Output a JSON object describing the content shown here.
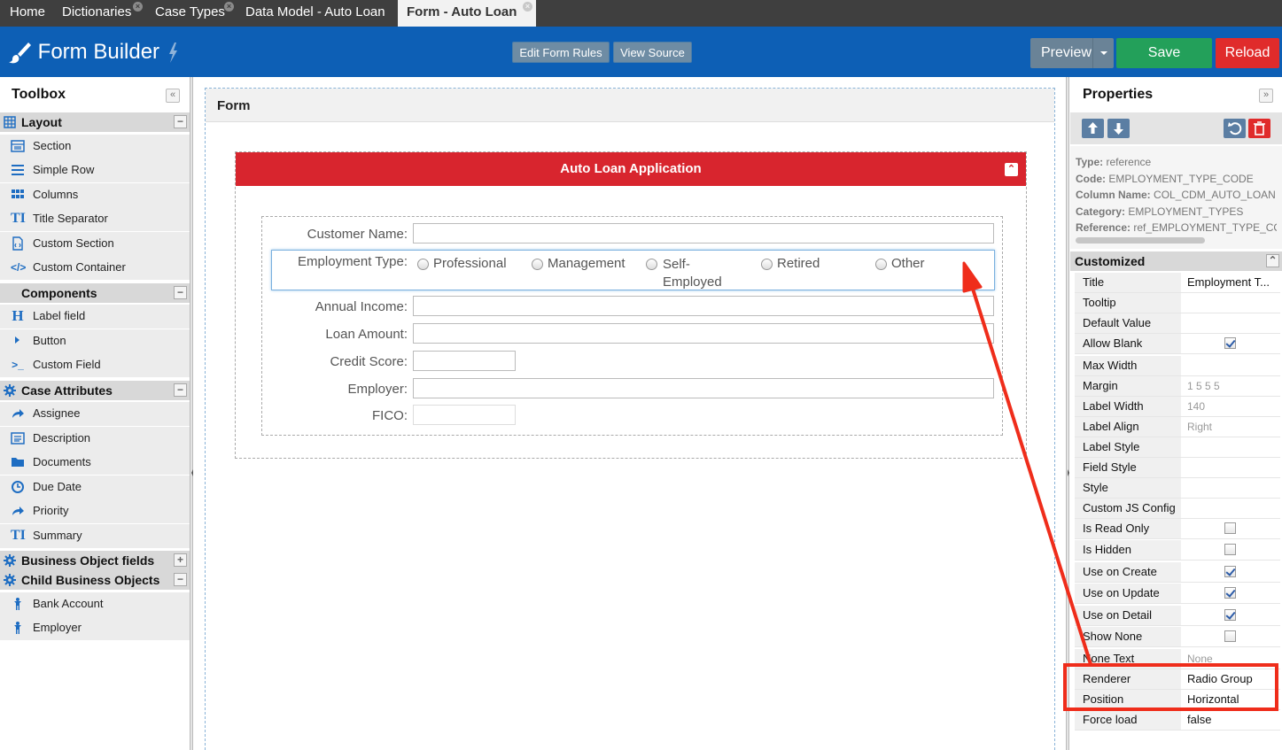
{
  "tabs": [
    {
      "label": "Home",
      "closable": false,
      "active": false
    },
    {
      "label": "Dictionaries",
      "closable": true,
      "active": false
    },
    {
      "label": "Case Types",
      "closable": true,
      "active": false
    },
    {
      "label": "Data Model - Auto Loan",
      "closable": false,
      "active": false
    },
    {
      "label": "Form - Auto Loan",
      "closable": true,
      "active": true
    }
  ],
  "header": {
    "title": "Form Builder",
    "edit_rules": "Edit Form Rules",
    "view_source": "View Source",
    "preview": "Preview",
    "save": "Save",
    "reload": "Reload",
    "colors": {
      "bar": "#0d5fb5",
      "save": "#23a05a",
      "reload": "#e02b2b",
      "preview": "#6a8397"
    }
  },
  "toolbox": {
    "title": "Toolbox",
    "collapse": "«",
    "groups": [
      {
        "label": "Layout",
        "toggle": "−",
        "icon": "table-icon",
        "items": [
          {
            "label": "Section",
            "icon": "section-icon"
          },
          {
            "label": "Simple Row",
            "icon": "rows-icon"
          },
          {
            "label": "Columns",
            "icon": "columns-icon"
          },
          {
            "label": "Title Separator",
            "icon": "title-icon"
          },
          {
            "label": "Custom Section",
            "icon": "custom-section-icon"
          },
          {
            "label": "Custom Container",
            "icon": "code-icon"
          }
        ]
      },
      {
        "label": "Components",
        "toggle": "−",
        "icon": "",
        "items": [
          {
            "label": "Label field",
            "icon": "heading-icon"
          },
          {
            "label": "Button",
            "icon": "caret-right-icon"
          },
          {
            "label": "Custom Field",
            "icon": "terminal-icon"
          }
        ]
      },
      {
        "label": "Case Attributes",
        "toggle": "−",
        "icon": "gear-icon",
        "items": [
          {
            "label": "Assignee",
            "icon": "share-icon"
          },
          {
            "label": "Description",
            "icon": "list-icon"
          },
          {
            "label": "Documents",
            "icon": "folder-icon"
          },
          {
            "label": "Due Date",
            "icon": "clock-icon"
          },
          {
            "label": "Priority",
            "icon": "share-icon"
          },
          {
            "label": "Summary",
            "icon": "title-icon"
          }
        ]
      },
      {
        "label": "Business Object fields",
        "toggle": "+",
        "icon": "gear-icon",
        "items": []
      },
      {
        "label": "Child Business Objects",
        "toggle": "−",
        "icon": "gear-icon",
        "items": [
          {
            "label": "Bank Account",
            "icon": "person-icon"
          },
          {
            "label": "Employer",
            "icon": "person-icon"
          }
        ]
      }
    ]
  },
  "canvas": {
    "title": "Form",
    "section_title": "Auto Loan Application",
    "fields": [
      {
        "label": "Customer Name:"
      },
      {
        "label": "Employment Type:"
      },
      {
        "label": "Annual Income:"
      },
      {
        "label": "Loan Amount:"
      },
      {
        "label": "Credit Score:"
      },
      {
        "label": "Employer:"
      },
      {
        "label": "FICO:"
      }
    ],
    "radio_options": [
      "Professional",
      "Management",
      "Self-Employed",
      "Retired",
      "Other"
    ],
    "radio_self_line1": "Self-",
    "radio_self_line2": "Employed"
  },
  "properties": {
    "title": "Properties",
    "collapse": "»",
    "meta": [
      {
        "key": "Type:",
        "value": "reference"
      },
      {
        "key": "Code:",
        "value": "EMPLOYMENT_TYPE_CODE"
      },
      {
        "key": "Column Name:",
        "value": "COL_CDM_AUTO_LOAN"
      },
      {
        "key": "Category:",
        "value": "EMPLOYMENT_TYPES"
      },
      {
        "key": "Reference:",
        "value": "ref_EMPLOYMENT_TYPE_CODE"
      }
    ],
    "section": "Customized",
    "section_toggle": "⌃",
    "rows": [
      {
        "key": "Title",
        "value": "Employment T...",
        "type": "text"
      },
      {
        "key": "Tooltip",
        "value": "",
        "type": "text"
      },
      {
        "key": "Default Value",
        "value": "",
        "type": "text"
      },
      {
        "key": "Allow Blank",
        "value": "",
        "type": "check",
        "checked": true
      },
      {
        "key": "Max Width",
        "value": "",
        "type": "text"
      },
      {
        "key": "Margin",
        "value": "1 5 5 5",
        "type": "muted"
      },
      {
        "key": "Label Width",
        "value": "140",
        "type": "muted"
      },
      {
        "key": "Label Align",
        "value": "Right",
        "type": "muted"
      },
      {
        "key": "Label Style",
        "value": "",
        "type": "text"
      },
      {
        "key": "Field Style",
        "value": "",
        "type": "text"
      },
      {
        "key": "Style",
        "value": "",
        "type": "text"
      },
      {
        "key": "Custom JS Config",
        "value": "",
        "type": "text"
      },
      {
        "key": "Is Read Only",
        "value": "",
        "type": "check",
        "checked": false
      },
      {
        "key": "Is Hidden",
        "value": "",
        "type": "check",
        "checked": false
      },
      {
        "key": "Use on Create",
        "value": "",
        "type": "check",
        "checked": true
      },
      {
        "key": "Use on Update",
        "value": "",
        "type": "check",
        "checked": true
      },
      {
        "key": "Use on Detail",
        "value": "",
        "type": "check",
        "checked": true
      },
      {
        "key": "Show None",
        "value": "",
        "type": "check",
        "checked": false
      },
      {
        "key": "None Text",
        "value": "None",
        "type": "muted"
      },
      {
        "key": "Renderer",
        "value": "Radio Group",
        "type": "text"
      },
      {
        "key": "Position",
        "value": "Horizontal",
        "type": "text"
      },
      {
        "key": "Force load",
        "value": "false",
        "type": "text"
      }
    ]
  }
}
